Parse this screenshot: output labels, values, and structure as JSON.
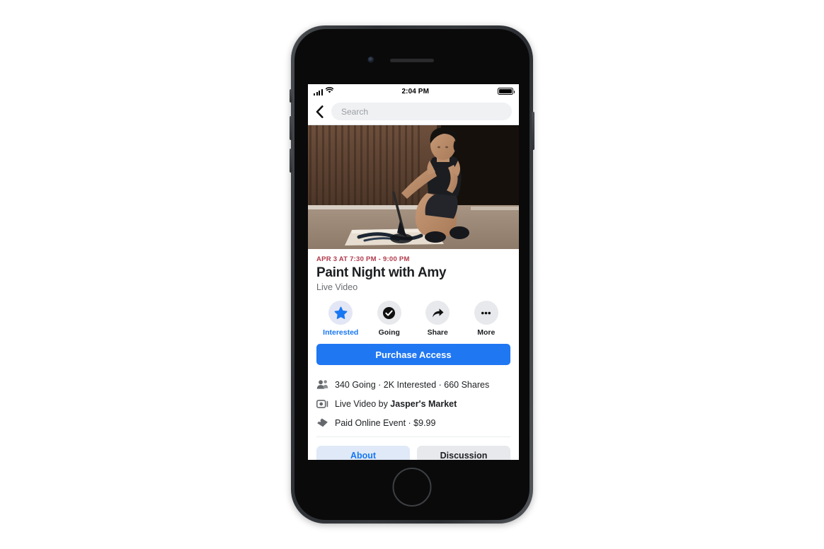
{
  "device": {
    "frame": "iphone-8-space-gray",
    "body_color": "#35383c"
  },
  "status_bar": {
    "time": "2:04 PM",
    "signal_icon": "cellular-signal-icon",
    "wifi_icon": "wifi-icon",
    "battery_icon": "battery-full-icon"
  },
  "navbar": {
    "back_icon": "back-chevron-icon",
    "search_placeholder": "Search",
    "search_value": ""
  },
  "cover": {
    "alt": "Woman crouching painting on a canvas on the floor in front of a rusted corrugated metal wall"
  },
  "event": {
    "date": "APR 3 AT 7:30 PM - 9:00 PM",
    "date_color": "#b03a4b",
    "title": "Paint Night with Amy",
    "subtitle": "Live Video"
  },
  "actions": [
    {
      "label": "Interested",
      "icon": "star-icon",
      "active": true
    },
    {
      "label": "Going",
      "icon": "check-circle-icon",
      "active": false
    },
    {
      "label": "Share",
      "icon": "share-arrow-icon",
      "active": false
    },
    {
      "label": "More",
      "icon": "ellipsis-icon",
      "active": false
    }
  ],
  "cta": {
    "label": "Purchase Access",
    "color": "#2077f2"
  },
  "info_rows": [
    {
      "icon": "people-group-icon",
      "text": "340 Going · 2K Interested · 660 Shares",
      "bold_part": ""
    },
    {
      "icon": "live-video-icon",
      "text_prefix": "Live Video by ",
      "text_bold": "Jasper's Market"
    },
    {
      "icon": "ticket-icon",
      "text": "Paid Online Event · $9.99",
      "bold_part": ""
    }
  ],
  "tabs": [
    {
      "label": "About",
      "style": "primary"
    },
    {
      "label": "Discussion",
      "style": "secondary"
    }
  ],
  "colors": {
    "accent_blue": "#1877f2",
    "cta_blue": "#2077f2",
    "date_maroon": "#b03a4b",
    "chip_blue_bg": "#dfe9f7",
    "chip_gray_bg": "#e7e9ec"
  }
}
